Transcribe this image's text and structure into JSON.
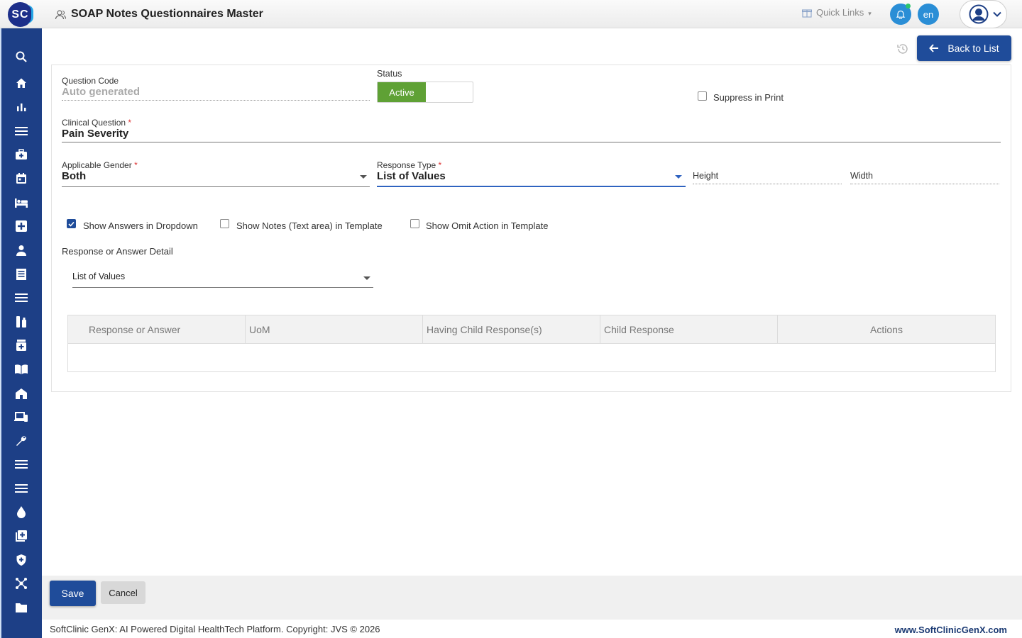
{
  "app": {
    "logo_text": "SC",
    "title": "SOAP Notes Questionnaires Master",
    "quick_links": "Quick Links",
    "language": "en"
  },
  "sidebar": {
    "items": [
      {
        "icon": "search-icon"
      },
      {
        "icon": "home-icon"
      },
      {
        "icon": "bar-chart-icon"
      },
      {
        "icon": "menu-icon"
      },
      {
        "icon": "medical-bag-icon"
      },
      {
        "icon": "calendar-icon"
      },
      {
        "icon": "bed-icon"
      },
      {
        "icon": "medical-plus-icon"
      },
      {
        "icon": "person-icon"
      },
      {
        "icon": "receipt-icon"
      },
      {
        "icon": "menu-icon"
      },
      {
        "icon": "lab-icon"
      },
      {
        "icon": "pharmacy-icon"
      },
      {
        "icon": "book-icon"
      },
      {
        "icon": "building-icon"
      },
      {
        "icon": "devices-icon"
      },
      {
        "icon": "wrench-icon"
      },
      {
        "icon": "menu-icon"
      },
      {
        "icon": "menu-icon"
      },
      {
        "icon": "drop-icon"
      },
      {
        "icon": "add-library-icon"
      },
      {
        "icon": "shield-icon"
      },
      {
        "icon": "network-icon"
      },
      {
        "icon": "folder-icon"
      }
    ]
  },
  "toolbar": {
    "back_label": "Back to List"
  },
  "form": {
    "question_code": {
      "label": "Question Code",
      "placeholder": "Auto generated"
    },
    "status": {
      "label": "Status",
      "value": "Active"
    },
    "suppress_print": {
      "label": "Suppress in Print",
      "checked": false
    },
    "clinical_question": {
      "label": "Clinical Question",
      "required": "*",
      "value": "Pain Severity"
    },
    "applicable_gender": {
      "label": "Applicable Gender",
      "required": "*",
      "value": "Both"
    },
    "response_type": {
      "label": "Response Type",
      "required": "*",
      "value": "List of Values"
    },
    "height": {
      "placeholder": "Height"
    },
    "width": {
      "placeholder": "Width"
    },
    "checkboxes": [
      {
        "label": "Show Answers in Dropdown",
        "checked": true
      },
      {
        "label": "Show Notes (Text area) in Template",
        "checked": false
      },
      {
        "label": "Show Omit Action in Template",
        "checked": false
      }
    ],
    "response_detail": {
      "label": "Response or Answer Detail",
      "value": "List of Values"
    }
  },
  "table": {
    "columns": [
      "Response or Answer",
      "UoM",
      "Having Child Response(s)",
      "Child Response",
      "Actions"
    ],
    "rows": []
  },
  "actions": {
    "save": "Save",
    "cancel": "Cancel"
  },
  "footer": {
    "copyright": "SoftClinic GenX: AI Powered Digital HealthTech Platform. Copyright: JVS © 2026",
    "website": "www.SoftClinicGenX.com"
  },
  "colors": {
    "primary": "#1f4c9a",
    "sidebar": "#1d3f86",
    "active_toggle": "#5fa135",
    "accent": "#2a8ed6"
  }
}
